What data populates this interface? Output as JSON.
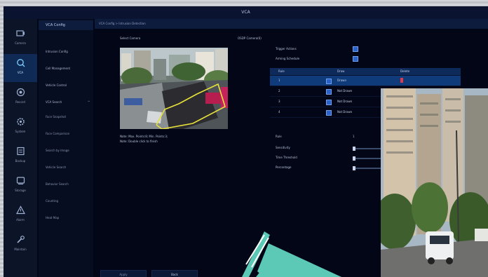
{
  "window": {
    "title": "VCA"
  },
  "sidebar_icons": [
    {
      "icon": "camera-icon",
      "label": "Camera"
    },
    {
      "icon": "vca-icon",
      "label": "VCA"
    },
    {
      "icon": "record-icon",
      "label": "Record"
    },
    {
      "icon": "system-icon",
      "label": "System"
    },
    {
      "icon": "backup-icon",
      "label": "Backup"
    },
    {
      "icon": "storage-icon",
      "label": "Storage"
    },
    {
      "icon": "alarm-icon",
      "label": "Alarm"
    },
    {
      "icon": "maintain-icon",
      "label": "Maintain"
    }
  ],
  "menu": {
    "header": "VCA Config",
    "items": [
      "Intrusion Config",
      "Cell Management",
      "Vehicle Control",
      "VCA Search",
      "Face Snapshot",
      "Face Comparison",
      "Search by Image",
      "Vehicle Search",
      "Behavior Search",
      "Counting",
      "Heat Map"
    ],
    "expander": "^"
  },
  "breadcrumb": "VCA Config > Intrusion Detection",
  "labels": {
    "select_camera": "Select Camera",
    "osd": "OSDP Camera(6)",
    "trigger_actions": "Trigger Actions",
    "arming_schedule": "Arming Schedule",
    "note1": "Note: Max. Points:8; Min. Points:3;",
    "note2": "Note: Double click to finish",
    "rule": "Rule",
    "rule_value": "1",
    "sensitivity": "Sensitivity",
    "time_threshold": "Time Threshold",
    "percentage": "Percentage"
  },
  "table": {
    "headers": [
      "Rule",
      "Draw",
      "Delete"
    ],
    "rows": [
      {
        "rule": "1",
        "draw": "Drawn",
        "delete": "delete"
      },
      {
        "rule": "2",
        "draw": "Not Drawn",
        "delete": ""
      },
      {
        "rule": "3",
        "draw": "Not Drawn",
        "delete": ""
      },
      {
        "rule": "4",
        "draw": "Not Drawn",
        "delete": ""
      }
    ]
  },
  "buttons": {
    "apply": "Apply",
    "back": "Back"
  },
  "colors": {
    "accent": "#1e6fd9",
    "active_row": "#0f3b7a",
    "selection_outline": "#e8e23a",
    "overlay_arrow": "#5cc9b6"
  }
}
